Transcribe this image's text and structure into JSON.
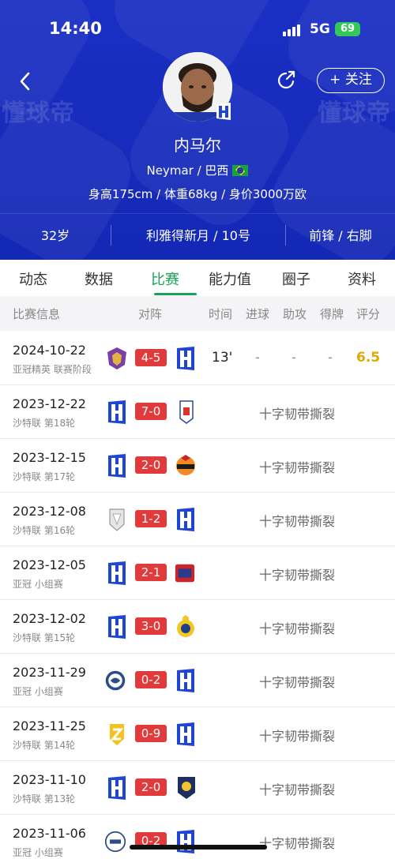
{
  "status_bar": {
    "time": "14:40",
    "network": "5G",
    "battery": "69"
  },
  "header": {
    "follow_label": "+ 关注",
    "watermark": "懂球帝",
    "player_name": "内马尔",
    "subtitle": "Neymar / 巴西",
    "stats": "身高175cm / 体重68kg / 身价3000万欧",
    "age": "32岁",
    "club": "利雅得新月 / 10号",
    "position": "前锋 / 右脚"
  },
  "tabs": [
    "动态",
    "数据",
    "比赛",
    "能力值",
    "圈子",
    "资料"
  ],
  "active_tab": "比赛",
  "table_headers": {
    "info": "比赛信息",
    "matchup": "对阵",
    "time": "时间",
    "goals": "进球",
    "assists": "助攻",
    "cards": "得牌",
    "rating": "评分"
  },
  "matches": [
    {
      "date": "2024-10-22",
      "competition": "亚冠精英 联赛阶段",
      "score": "4-5",
      "minutes": "13'",
      "goals": "-",
      "assists": "-",
      "cards": "-",
      "rating": "6.5",
      "status": ""
    },
    {
      "date": "2023-12-22",
      "competition": "沙特联 第18轮",
      "score": "7-0",
      "status": "十字韧带撕裂"
    },
    {
      "date": "2023-12-15",
      "competition": "沙特联 第17轮",
      "score": "2-0",
      "status": "十字韧带撕裂"
    },
    {
      "date": "2023-12-08",
      "competition": "沙特联 第16轮",
      "score": "1-2",
      "status": "十字韧带撕裂"
    },
    {
      "date": "2023-12-05",
      "competition": "亚冠 小组赛",
      "score": "2-1",
      "status": "十字韧带撕裂"
    },
    {
      "date": "2023-12-02",
      "competition": "沙特联 第15轮",
      "score": "3-0",
      "status": "十字韧带撕裂"
    },
    {
      "date": "2023-11-29",
      "competition": "亚冠 小组赛",
      "score": "0-2",
      "status": "十字韧带撕裂"
    },
    {
      "date": "2023-11-25",
      "competition": "沙特联 第14轮",
      "score": "0-9",
      "status": "十字韧带撕裂"
    },
    {
      "date": "2023-11-10",
      "competition": "沙特联 第13轮",
      "score": "2-0",
      "status": "十字韧带撕裂"
    },
    {
      "date": "2023-11-06",
      "competition": "亚冠 小组赛",
      "score": "0-2",
      "status": "十字韧带撕裂"
    }
  ],
  "colors": {
    "header_blue": "#1a2fc4",
    "accent_green": "#19a35a",
    "score_red": "#e23a3a",
    "rating_gold": "#e0a800"
  }
}
